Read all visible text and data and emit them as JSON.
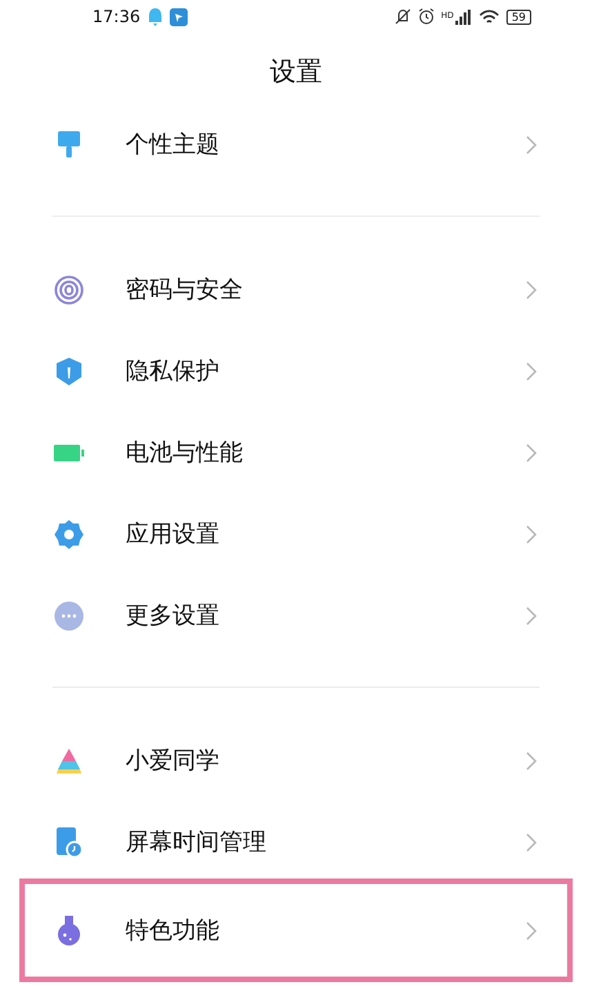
{
  "status_bar": {
    "time": "17:36",
    "network_label": "HD",
    "battery": "59"
  },
  "title": "设置",
  "sections": [
    {
      "items": [
        {
          "label": "个性主题",
          "kind": "theme",
          "highlighted": false
        }
      ]
    },
    {
      "items": [
        {
          "label": "密码与安全",
          "kind": "fingerprint",
          "highlighted": false
        },
        {
          "label": "隐私保护",
          "kind": "shield",
          "highlighted": false
        },
        {
          "label": "电池与性能",
          "kind": "battery",
          "highlighted": false
        },
        {
          "label": "应用设置",
          "kind": "gear",
          "highlighted": false
        },
        {
          "label": "更多设置",
          "kind": "more",
          "highlighted": false
        }
      ]
    },
    {
      "items": [
        {
          "label": "小爱同学",
          "kind": "assistant",
          "highlighted": false
        },
        {
          "label": "屏幕时间管理",
          "kind": "screentime",
          "highlighted": false
        },
        {
          "label": "特色功能",
          "kind": "flask",
          "highlighted": true
        }
      ]
    }
  ]
}
